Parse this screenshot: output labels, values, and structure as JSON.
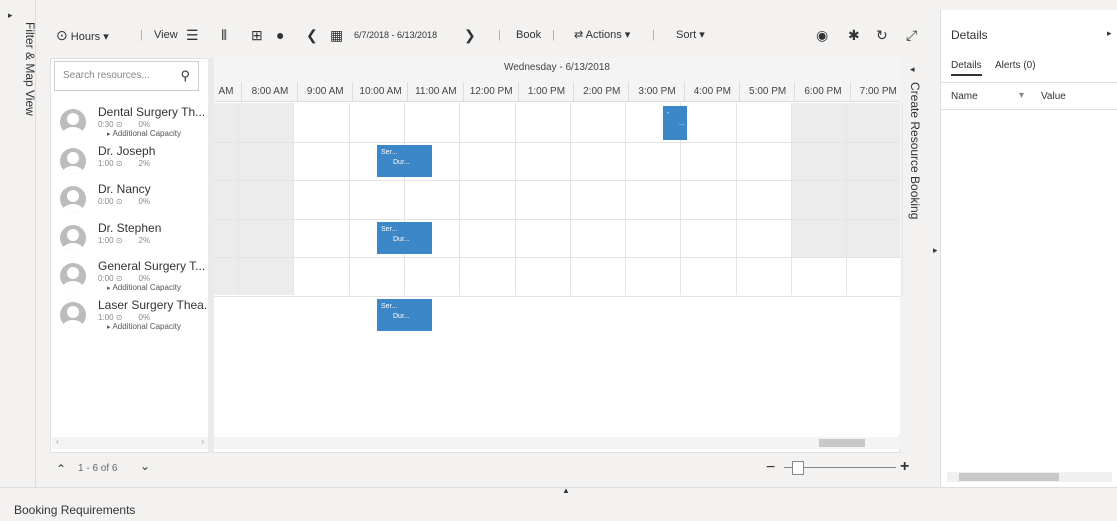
{
  "left_panel": {
    "toggle": "▸",
    "label": "Filter & Map View"
  },
  "toolbar": {
    "view_mode": "Hours",
    "view_label": "View",
    "date_range": "6/7/2018 - 6/13/2018",
    "book": "Book",
    "actions": "Actions",
    "sort": "Sort"
  },
  "search": {
    "placeholder": "Search resources..."
  },
  "timeline": {
    "day": "Wednesday - 6/13/2018",
    "hours": [
      "AM",
      "8:00 AM",
      "9:00 AM",
      "10:00 AM",
      "11:00 AM",
      "12:00 PM",
      "1:00 PM",
      "2:00 PM",
      "3:00 PM",
      "4:00 PM",
      "5:00 PM",
      "6:00 PM",
      "7:00 PM"
    ]
  },
  "resources": [
    {
      "name": "Dental Surgery Th...",
      "hours": "0:30",
      "pct": "0%",
      "capacity": "Additional Capacity"
    },
    {
      "name": "Dr. Joseph",
      "hours": "1:00",
      "pct": "2%"
    },
    {
      "name": "Dr. Nancy",
      "hours": "0:00",
      "pct": "0%"
    },
    {
      "name": "Dr. Stephen",
      "hours": "1:00",
      "pct": "2%"
    },
    {
      "name": "General Surgery T...",
      "hours": "0:00",
      "pct": "0%",
      "capacity": "Additional Capacity"
    },
    {
      "name": "Laser Surgery Thea...",
      "hours": "1:00",
      "pct": "0%",
      "capacity": "Additional Capacity"
    }
  ],
  "bookings": [
    {
      "line1": "-",
      "line2": "...",
      "resource": "Dental Surgery Th..."
    },
    {
      "line1": "Ser...",
      "line2": "Dur...",
      "resource": "Dr. Joseph"
    },
    {
      "line1": "Ser...",
      "line2": "Dur...",
      "resource": "Dr. Stephen"
    },
    {
      "line1": "Ser...",
      "line2": "Dur...",
      "resource": "Laser Surgery Thea..."
    }
  ],
  "paging": {
    "text": "1 - 6 of 6"
  },
  "create_booking": {
    "label": "Create Resource Booking"
  },
  "details": {
    "title": "Details",
    "tabs": [
      "Details",
      "Alerts (0)"
    ],
    "columns": [
      "Name",
      "Value"
    ]
  },
  "bottom": {
    "label": "Booking Requirements"
  },
  "colors": {
    "booking": "#3b87c8"
  }
}
